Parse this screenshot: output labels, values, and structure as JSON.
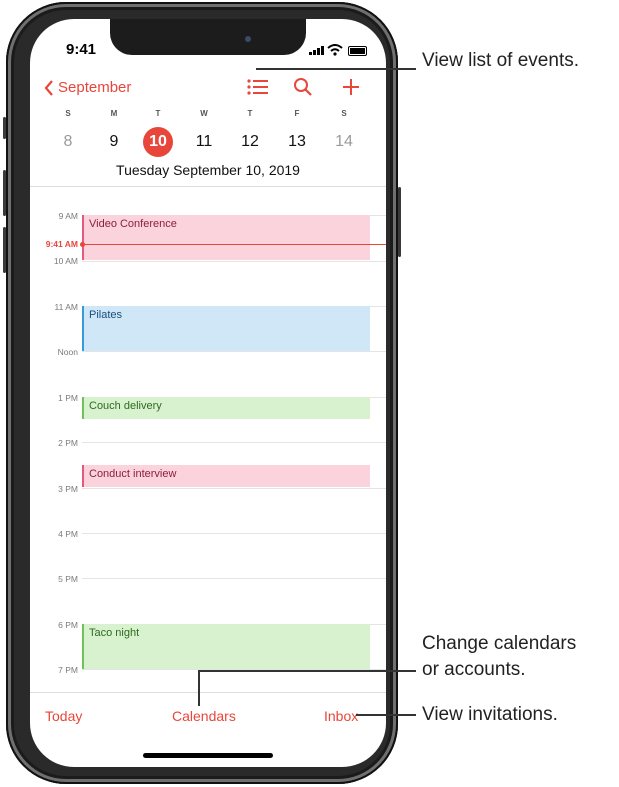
{
  "status": {
    "time": "9:41"
  },
  "nav": {
    "back_label": "September",
    "list_icon": "list-icon",
    "search_icon": "search-icon",
    "add_icon": "plus-icon"
  },
  "week": {
    "days": [
      {
        "letter": "S",
        "num": "8"
      },
      {
        "letter": "M",
        "num": "9"
      },
      {
        "letter": "T",
        "num": "10"
      },
      {
        "letter": "W",
        "num": "11"
      },
      {
        "letter": "T",
        "num": "12"
      },
      {
        "letter": "F",
        "num": "13"
      },
      {
        "letter": "S",
        "num": "14"
      }
    ],
    "selected_date": "Tuesday  September 10, 2019"
  },
  "timeline": {
    "hours": [
      "9 AM",
      "10 AM",
      "11 AM",
      "Noon",
      "1 PM",
      "2 PM",
      "3 PM",
      "4 PM",
      "5 PM",
      "6 PM",
      "7 PM"
    ],
    "now_label": "9:41 AM",
    "events": [
      {
        "title": "Video Conference"
      },
      {
        "title": "Pilates"
      },
      {
        "title": "Couch delivery"
      },
      {
        "title": "Conduct interview"
      },
      {
        "title": "Taco night"
      }
    ]
  },
  "tabbar": {
    "today": "Today",
    "calendars": "Calendars",
    "inbox": "Inbox"
  },
  "callouts": {
    "list": "View list of events.",
    "calendars_line1": "Change calendars",
    "calendars_line2": "or accounts.",
    "inbox": "View invitations."
  },
  "colors": {
    "accent": "#e8463b",
    "event_pink": "#fbd3dd",
    "event_blue": "#cfe7f7",
    "event_green": "#d8f2cf"
  }
}
